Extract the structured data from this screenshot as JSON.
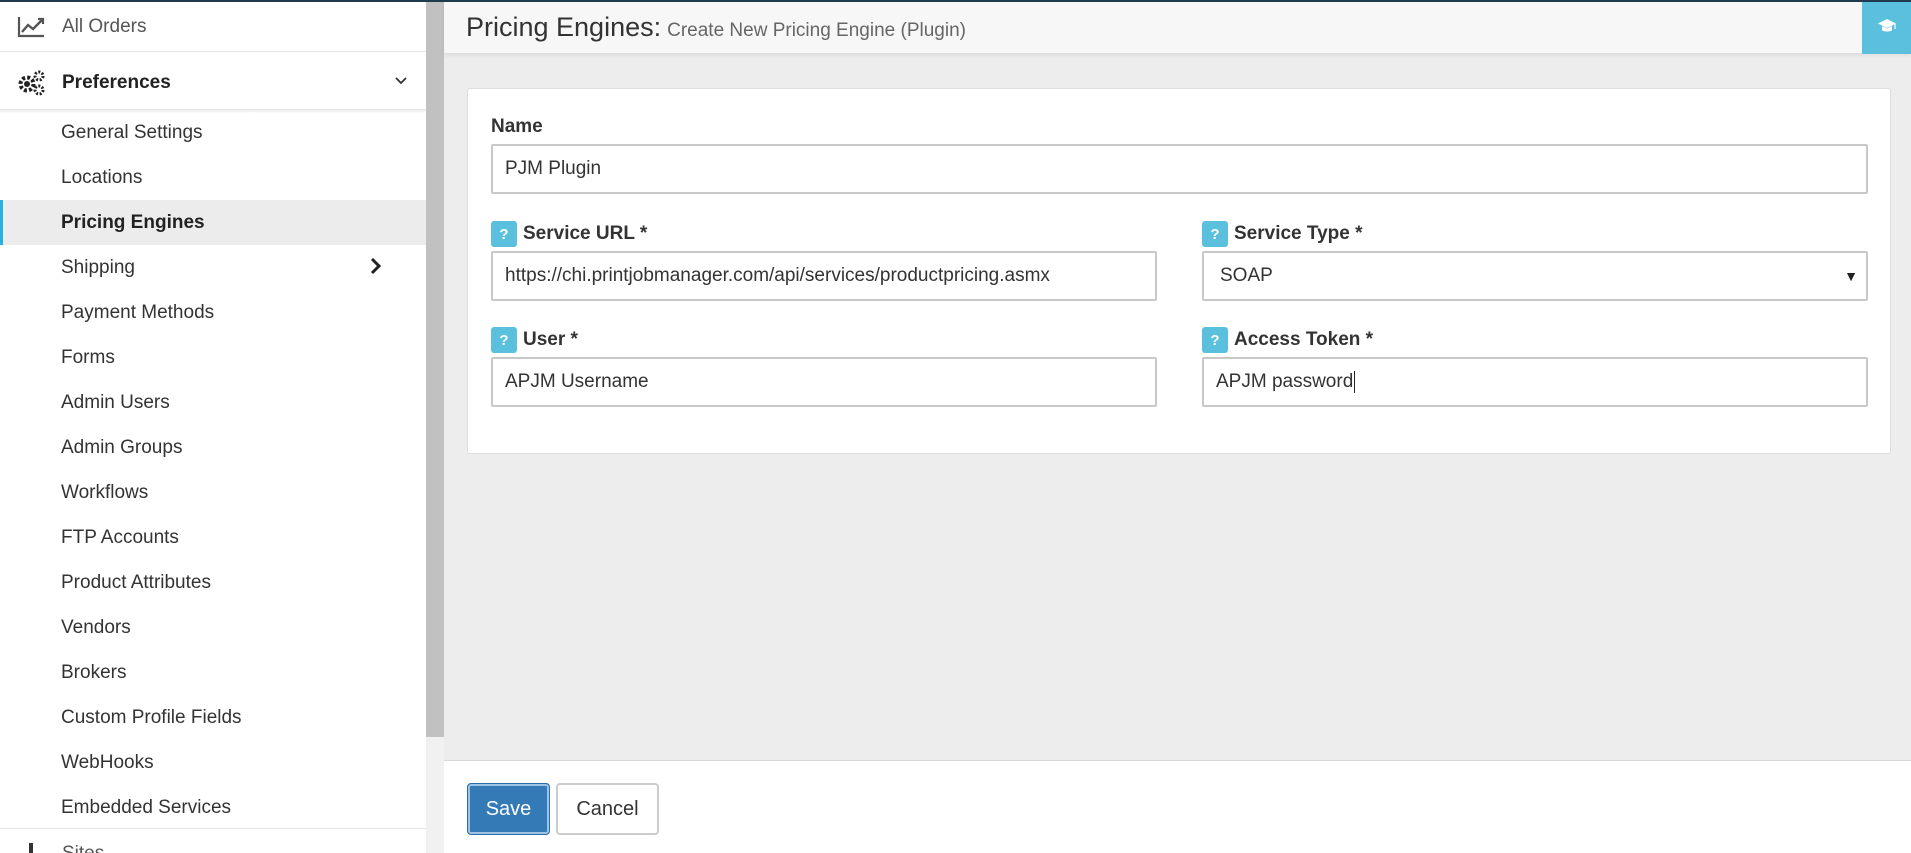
{
  "header": {
    "title": "Pricing Engines:",
    "subtitle": "Create New Pricing Engine (Plugin)",
    "help_icon": "graduation-cap-icon"
  },
  "sidebar": {
    "all_orders": {
      "label": "All Orders",
      "icon": "line-chart-icon"
    },
    "preferences": {
      "label": "Preferences",
      "icon": "gears-icon"
    },
    "items": [
      {
        "label": "General Settings"
      },
      {
        "label": "Locations"
      },
      {
        "label": "Pricing Engines",
        "active": true
      },
      {
        "label": "Shipping",
        "has_submenu": true
      },
      {
        "label": "Payment Methods"
      },
      {
        "label": "Forms"
      },
      {
        "label": "Admin Users"
      },
      {
        "label": "Admin Groups"
      },
      {
        "label": "Workflows"
      },
      {
        "label": "FTP Accounts"
      },
      {
        "label": "Product Attributes"
      },
      {
        "label": "Vendors"
      },
      {
        "label": "Brokers"
      },
      {
        "label": "Custom Profile Fields"
      },
      {
        "label": "WebHooks"
      },
      {
        "label": "Embedded Services"
      }
    ],
    "next_section": {
      "label": "Sites"
    }
  },
  "form": {
    "name": {
      "label": "Name",
      "value": "PJM Plugin"
    },
    "service_url": {
      "label": "Service URL *",
      "help": "?",
      "value": "https://chi.printjobmanager.com/api/services/productpricing.asmx"
    },
    "service_type": {
      "label": "Service Type *",
      "help": "?",
      "value": "SOAP"
    },
    "user": {
      "label": "User *",
      "help": "?",
      "value": "APJM Username"
    },
    "access_token": {
      "label": "Access Token *",
      "help": "?",
      "value": "APJM password"
    }
  },
  "footer": {
    "save_label": "Save",
    "cancel_label": "Cancel"
  },
  "colors": {
    "accent": "#5bc0de",
    "primary_button": "#337ab7",
    "active_indicator": "#2ab0e0"
  }
}
